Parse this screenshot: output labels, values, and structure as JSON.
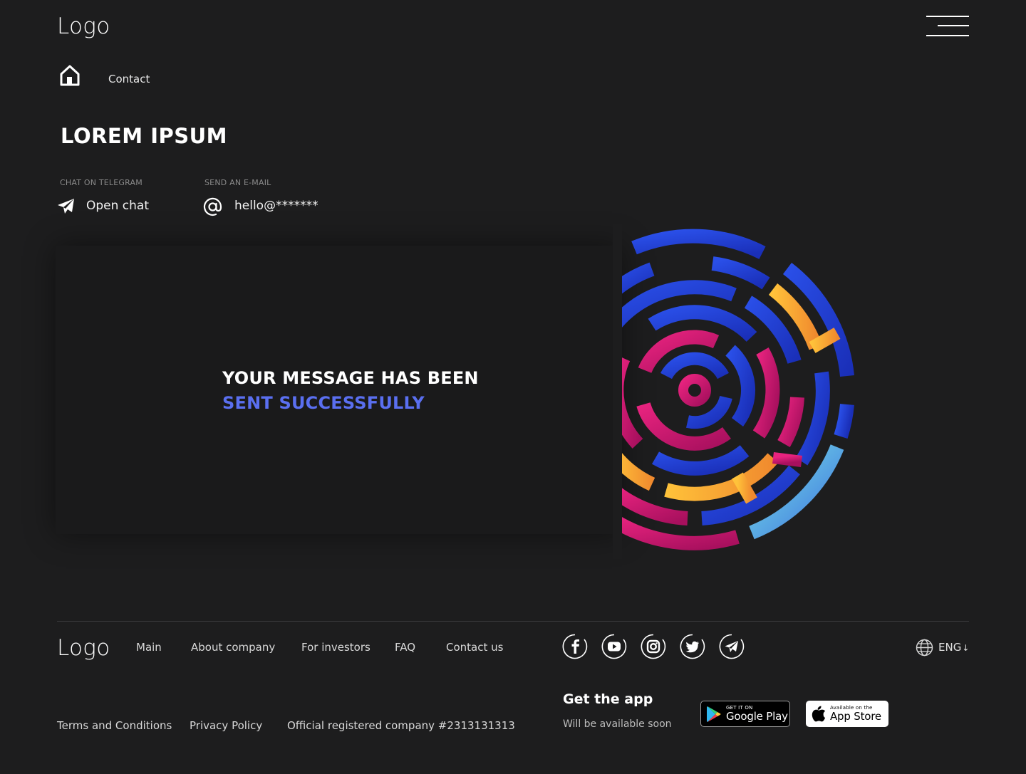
{
  "header": {
    "logo": "Logo"
  },
  "breadcrumb": {
    "current": "Contact"
  },
  "page": {
    "title": "LOREM IPSUM"
  },
  "contacts": {
    "telegram": {
      "caption": "CHAT ON TELEGRAM",
      "label": "Open chat"
    },
    "email": {
      "caption": "SEND AN E-MAIL",
      "label": "hello@*******"
    }
  },
  "message": {
    "line1": "YOUR MESSAGE HAS BEEN",
    "line2": "SENT SUCCESSFULLY"
  },
  "footer": {
    "logo": "Logo",
    "nav": [
      "Main",
      "About company",
      "For investors",
      "FAQ",
      "Contact us"
    ],
    "social_icons": [
      "facebook-icon",
      "youtube-icon",
      "instagram-icon",
      "twitter-icon",
      "telegram-icon"
    ],
    "language": "ENG",
    "links": [
      "Terms and Conditions",
      "Privacy Policy",
      "Official registered company #2313131313"
    ],
    "app": {
      "title": "Get the app",
      "subtitle": "Will be available soon",
      "google_play": {
        "small": "GET IT ON",
        "big": "Google Play"
      },
      "app_store": {
        "small": "Available on the",
        "big": "App Store"
      }
    }
  },
  "colors": {
    "background": "#1d1d1e",
    "accent_blue": "#5a6ff0",
    "maze_blue": "#1f3fd6",
    "maze_magenta": "#c8166e",
    "maze_orange": "#f4a533",
    "maze_cyan": "#5fd6df"
  }
}
